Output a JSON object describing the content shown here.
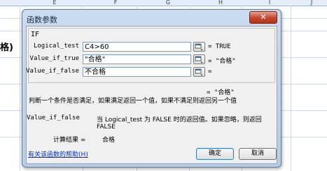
{
  "spreadsheet": {
    "columns": [
      "E",
      "F",
      "G",
      "H",
      "I",
      "J"
    ],
    "partial_cell_text": "格)"
  },
  "dialog": {
    "title": "函数参数",
    "close_symbol": "✕",
    "function_name": "IF",
    "args": [
      {
        "label": "Logical_test",
        "value": "C4>60",
        "result": "= TRUE"
      },
      {
        "label": "Value_if_true",
        "value": "\"合格\"",
        "result": "= \"合格\""
      },
      {
        "label": "Value_if_false",
        "value": "不合格",
        "result": "="
      }
    ],
    "overall_result": "= \"合格\"",
    "description": "判断一个条件是否满足，如果满足返回一个值，如果不满足则返回另一个值",
    "param_name": "Value_if_false",
    "param_description": "当 Logical_test 为 FALSE 时的返回值。如果忽略，则返回 FALSE",
    "calc_label": "计算结果 =",
    "calc_value": "合格",
    "help_link": "有关该函数的帮助(H)",
    "ok_label": "确定",
    "cancel_label": "取消"
  }
}
